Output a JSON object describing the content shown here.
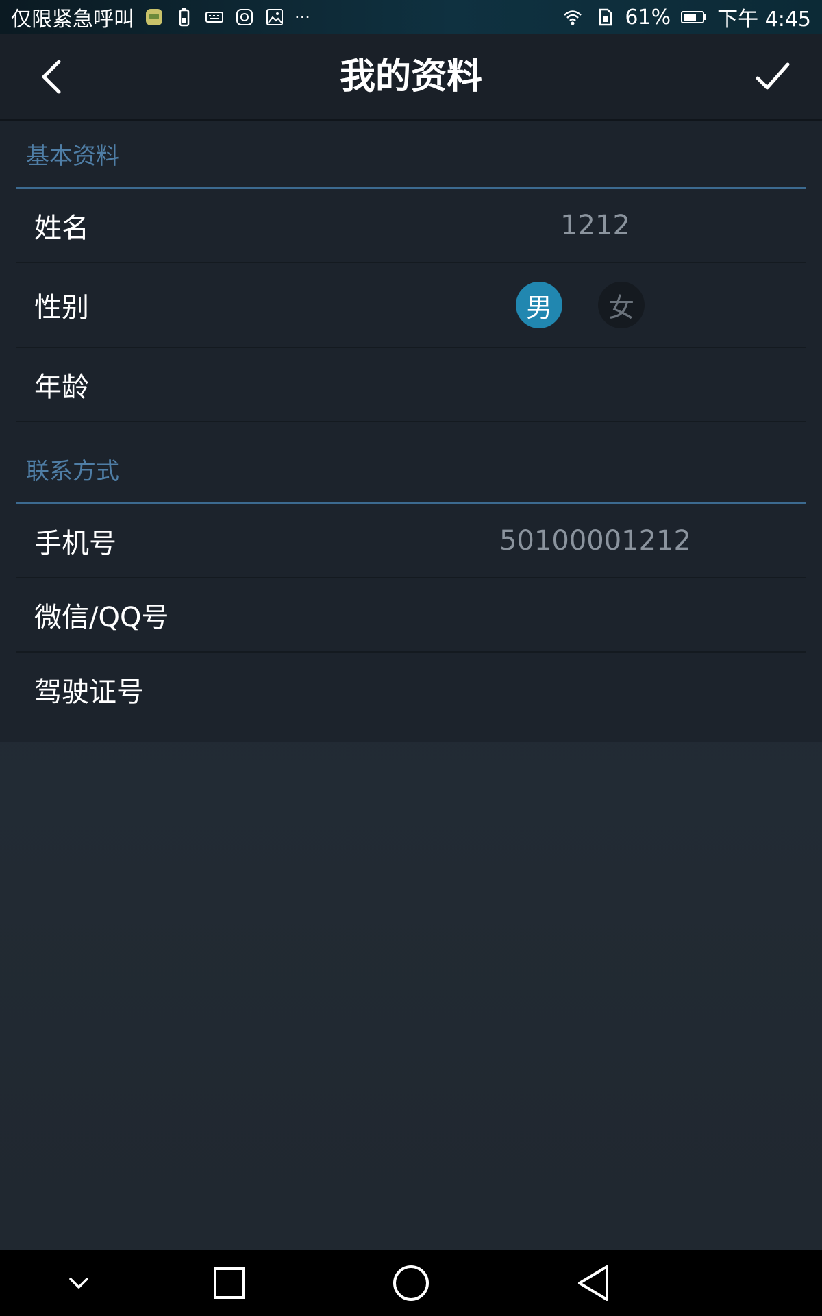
{
  "status_bar": {
    "carrier_text": "仅限紧急呼叫",
    "more_text": "···",
    "battery_percent": "61%",
    "time": "下午 4:45",
    "icons": [
      "app-notification-icon",
      "battery-alert-icon",
      "keyboard-icon",
      "camera-app-icon",
      "image-icon",
      "wifi-icon",
      "sim-card-icon",
      "battery-icon"
    ]
  },
  "header": {
    "title": "我的资料",
    "back_icon": "chevron-left-icon",
    "confirm_icon": "checkmark-icon"
  },
  "basic_section": {
    "title": "基本资料",
    "name_label": "姓名",
    "name_value": "1212",
    "gender_label": "性别",
    "gender_male": "男",
    "gender_female": "女",
    "gender_selected": "男",
    "age_label": "年龄",
    "age_value": ""
  },
  "contact_section": {
    "title": "联系方式",
    "phone_label": "手机号",
    "phone_value": "50100001212",
    "wechat_qq_label": "微信/QQ号",
    "wechat_qq_value": "",
    "license_label": "驾驶证号",
    "license_value": ""
  },
  "nav_bar": {
    "icons": [
      "chevron-down-icon",
      "recent-apps-icon",
      "home-icon",
      "back-triangle-icon"
    ]
  },
  "colors": {
    "accent": "#2187b0",
    "section_title": "#4f7ea6",
    "section_line": "#3c6a90"
  }
}
